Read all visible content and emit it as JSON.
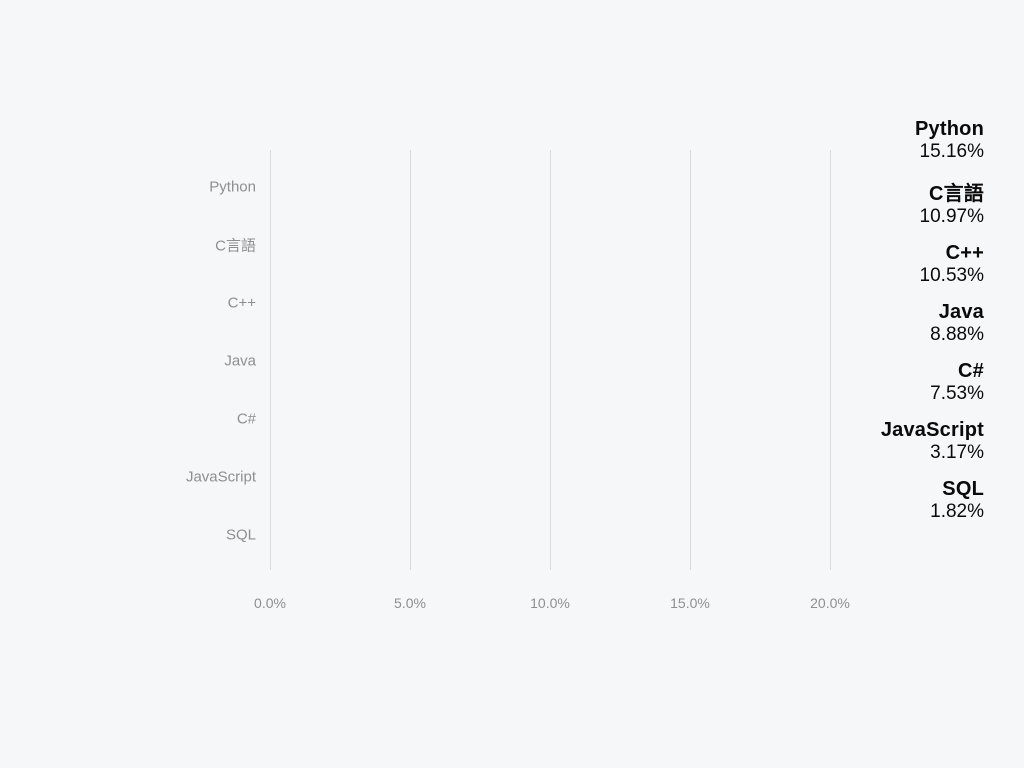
{
  "chart_data": {
    "type": "bar",
    "orientation": "horizontal",
    "categories": [
      "Python",
      "C言語",
      "C++",
      "Java",
      "C#",
      "JavaScript",
      "SQL"
    ],
    "values": [
      15.16,
      10.97,
      10.53,
      8.88,
      7.53,
      3.17,
      1.82
    ],
    "value_labels": [
      "15.16%",
      "10.97%",
      "10.53%",
      "8.88%",
      "7.53%",
      "3.17%",
      "1.82%"
    ],
    "xlim": [
      0,
      20
    ],
    "x_ticks": [
      0,
      5,
      10,
      15,
      20
    ],
    "x_tick_labels": [
      "0.0%",
      "5.0%",
      "10.0%",
      "15.0%",
      "20.0%"
    ],
    "bar_color": "#f4c20d",
    "title": "",
    "xlabel": "",
    "ylabel": ""
  },
  "legend": {
    "items": [
      {
        "name": "Python",
        "value": "15.16%"
      },
      {
        "name": "C言語",
        "value": "10.97%"
      },
      {
        "name": "C++",
        "value": "10.53%"
      },
      {
        "name": "Java",
        "value": "8.88%"
      },
      {
        "name": "C#",
        "value": "7.53%"
      },
      {
        "name": "JavaScript",
        "value": "3.17%"
      },
      {
        "name": "SQL",
        "value": "1.82%"
      }
    ]
  }
}
